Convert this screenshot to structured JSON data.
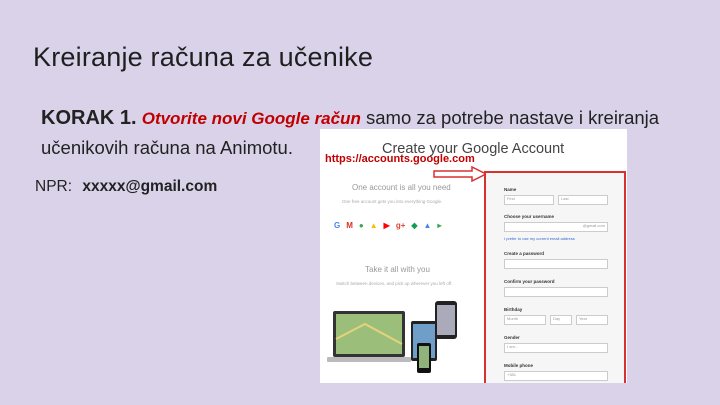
{
  "slide": {
    "title": "Kreiranje računa za učenike",
    "step_label": "KORAK 1.",
    "step_highlight": "Otvorite novi Google račun",
    "step_text_1": " samo za potrebe nastave i kreiranja",
    "step_text_2": "učenikovih računa na Animotu.",
    "npr_label": "NPR:",
    "npr_email": "xxxxx@gmail.com"
  },
  "screenshot": {
    "url_text": "https://accounts.google.com",
    "header": "Create your Google Account",
    "left_heading": "One account is all you need",
    "left_sub": "One free account gets you into everything Google.",
    "left_heading_2": "Take it all with you",
    "left_sub_2": "Switch between devices, and pick up wherever you left off.",
    "product_icons": [
      "G",
      "M",
      "●",
      "▲",
      "▶",
      "g+",
      "◆",
      "▲",
      "▸"
    ],
    "form": {
      "name_label": "Name",
      "first_placeholder": "First",
      "last_placeholder": "Last",
      "username_label": "Choose your username",
      "username_suffix": "@gmail.com",
      "current_email_link": "I prefer to use my current email address",
      "password_label": "Create a password",
      "confirm_label": "Confirm your password",
      "birthday_label": "Birthday",
      "month_value": "Month",
      "day_placeholder": "Day",
      "year_placeholder": "Year",
      "gender_label": "Gender",
      "gender_value": "I am...",
      "mobile_label": "Mobile phone",
      "mobile_value": "+381"
    }
  },
  "colors": {
    "background": "#d9d2e9",
    "highlight": "#c00000",
    "form_border": "#d93030"
  }
}
